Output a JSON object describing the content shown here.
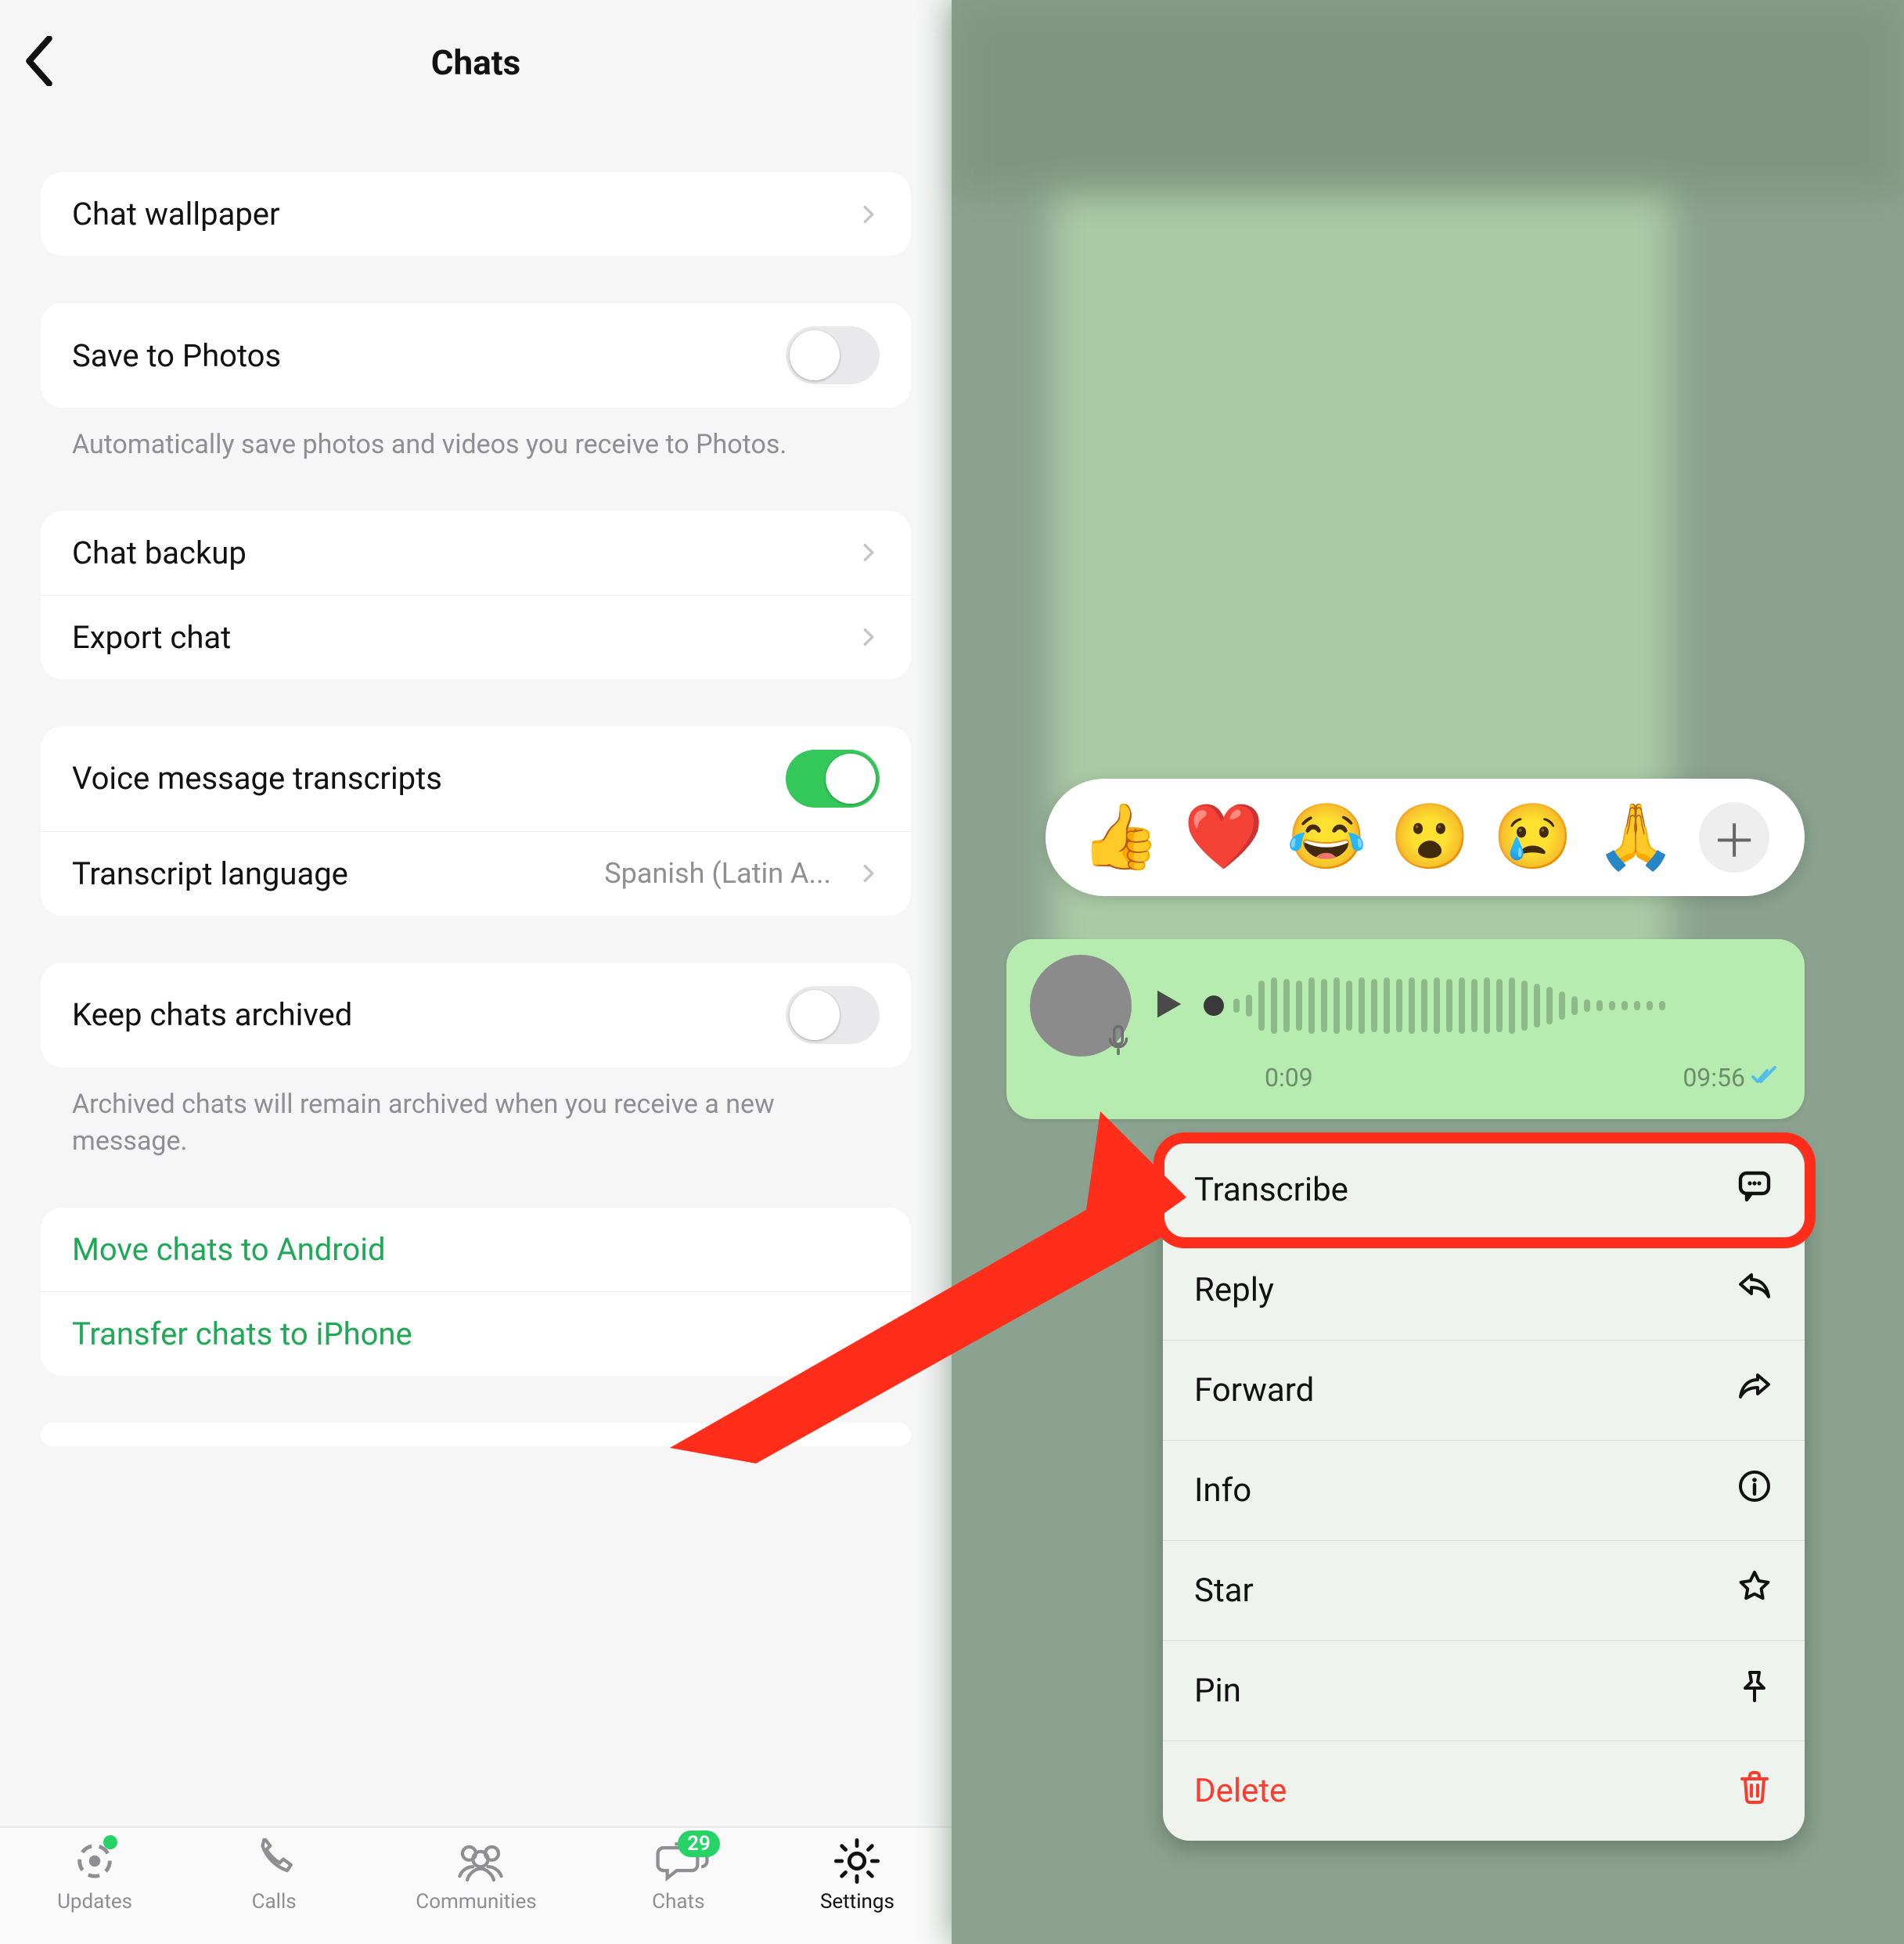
{
  "left": {
    "title": "Chats",
    "groups": {
      "wallpaper": {
        "chat_wallpaper": "Chat wallpaper"
      },
      "save": {
        "save_to_photos": "Save to Photos",
        "save_note": "Automatically save photos and videos you receive to Photos."
      },
      "backup": {
        "chat_backup": "Chat backup",
        "export_chat": "Export chat"
      },
      "transcripts": {
        "voice_transcripts": "Voice message transcripts",
        "transcript_language_label": "Transcript language",
        "transcript_language_value": "Spanish (Latin A..."
      },
      "archive": {
        "keep_archived": "Keep chats archived",
        "archive_note": "Archived chats will remain archived when you receive a new message."
      },
      "transfer": {
        "move_android": "Move chats to Android",
        "transfer_iphone": "Transfer chats to iPhone"
      }
    },
    "tabs": {
      "updates": "Updates",
      "calls": "Calls",
      "communities": "Communities",
      "chats": "Chats",
      "chats_badge": "29",
      "settings": "Settings"
    }
  },
  "right": {
    "reactions": [
      "👍",
      "❤️",
      "😂",
      "😮",
      "😢",
      "🙏"
    ],
    "voice": {
      "elapsed": "0:09",
      "total": "09:56"
    },
    "menu": {
      "transcribe": "Transcribe",
      "reply": "Reply",
      "forward": "Forward",
      "info": "Info",
      "star": "Star",
      "pin": "Pin",
      "delete": "Delete"
    }
  }
}
